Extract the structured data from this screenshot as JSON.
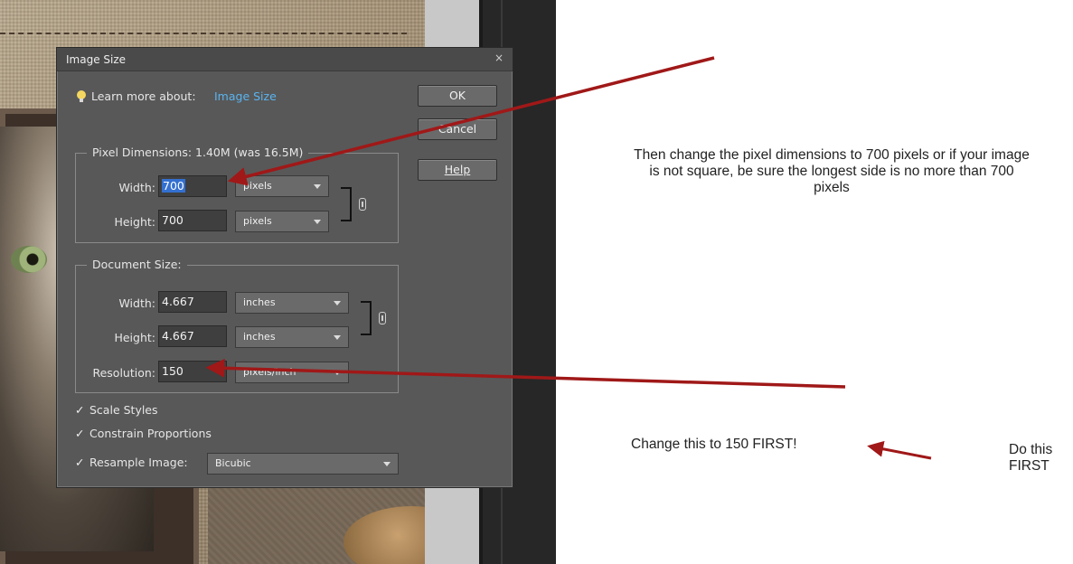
{
  "dialog": {
    "title": "Image Size",
    "close_glyph": "×",
    "learn_prefix": "Learn more about:",
    "learn_link": "Image Size",
    "buttons": {
      "ok": "OK",
      "cancel": "Cancel",
      "help": "Help"
    },
    "pixel_dimensions": {
      "legend": "Pixel Dimensions:  1.40M (was 16.5M)",
      "width_label": "Width:",
      "width_value": "700",
      "width_unit": "pixels",
      "height_label": "Height:",
      "height_value": "700",
      "height_unit": "pixels"
    },
    "document_size": {
      "legend": "Document Size:",
      "width_label": "Width:",
      "width_value": "4.667",
      "width_unit": "inches",
      "height_label": "Height:",
      "height_value": "4.667",
      "height_unit": "inches",
      "resolution_label": "Resolution:",
      "resolution_value": "150",
      "resolution_unit": "pixels/inch"
    },
    "options": {
      "scale_styles": {
        "label": "Scale Styles",
        "checked": true
      },
      "constrain_proportions": {
        "label": "Constrain Proportions",
        "checked": true
      },
      "resample_image": {
        "label": "Resample Image:",
        "checked": true,
        "method": "Bicubic"
      }
    },
    "check_glyph": "✓"
  },
  "annotations": {
    "note1": "Then change the pixel dimensions to 700 pixels or if your image is not square, be sure the longest side is no more than 700 pixels",
    "note2": "Change this to 150 FIRST!",
    "note3": "Do this FIRST",
    "arrow_color": "#a01818"
  },
  "icons": [
    "lightbulb-icon",
    "close-icon",
    "chain-link-icon",
    "dropdown-caret-icon",
    "checkmark-icon"
  ]
}
